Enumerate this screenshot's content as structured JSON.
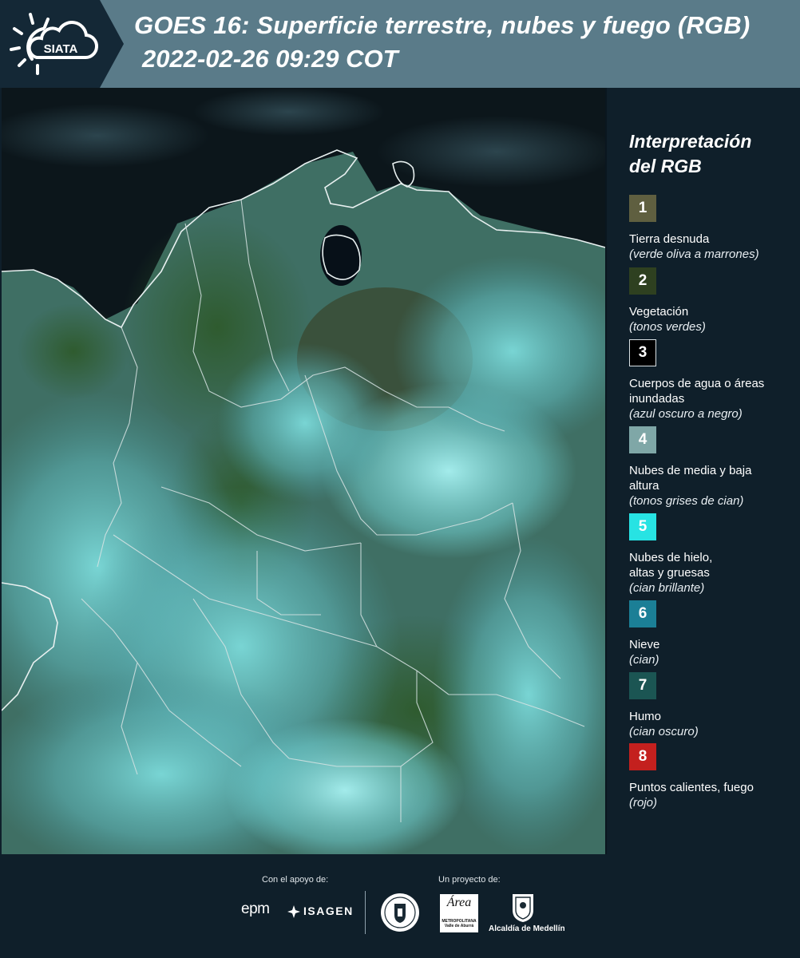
{
  "header": {
    "logo_text": "SIATA",
    "title_line1": "GOES 16: Superficie terrestre, nubes y fuego (RGB)",
    "title_line2": "2022-02-26 09:29 COT"
  },
  "legend": {
    "title_line1": "Interpretación",
    "title_line2": "del RGB",
    "items": [
      {
        "num": "1",
        "label": "Tierra desnuda",
        "sub": "(verde oliva a marrones)",
        "color": "#5f5f40"
      },
      {
        "num": "2",
        "label": "Vegetación",
        "sub": "(tonos verdes)",
        "color": "#2e4020"
      },
      {
        "num": "3",
        "label": "Cuerpos de agua o áreas inundadas",
        "sub": "(azul oscuro a negro)",
        "color": "#000000"
      },
      {
        "num": "4",
        "label": "Nubes de media y baja altura",
        "sub": "(tonos grises de cian)",
        "color": "#7fa7a7"
      },
      {
        "num": "5",
        "label": "Nubes de hielo, altas y gruesas",
        "sub": "(cian brillante)",
        "color": "#27e3e3"
      },
      {
        "num": "6",
        "label": "Nieve",
        "sub": "(cian)",
        "color": "#1b7f96"
      },
      {
        "num": "7",
        "label": "Humo",
        "sub": "(cian oscuro)",
        "color": "#1b5553"
      },
      {
        "num": "8",
        "label": "Puntos calientes, fuego",
        "sub": "(rojo)",
        "color": "#c4201e"
      }
    ]
  },
  "footer": {
    "support_label": "Con el apoyo de:",
    "project_label": "Un proyecto de:",
    "epm": "epm",
    "isagen": "ISAGEN",
    "area_logo_text": "Área",
    "area_logo_sub": "METROPOLITANA Valle de Aburrá",
    "medellin": "Alcaldía de Medellín"
  }
}
